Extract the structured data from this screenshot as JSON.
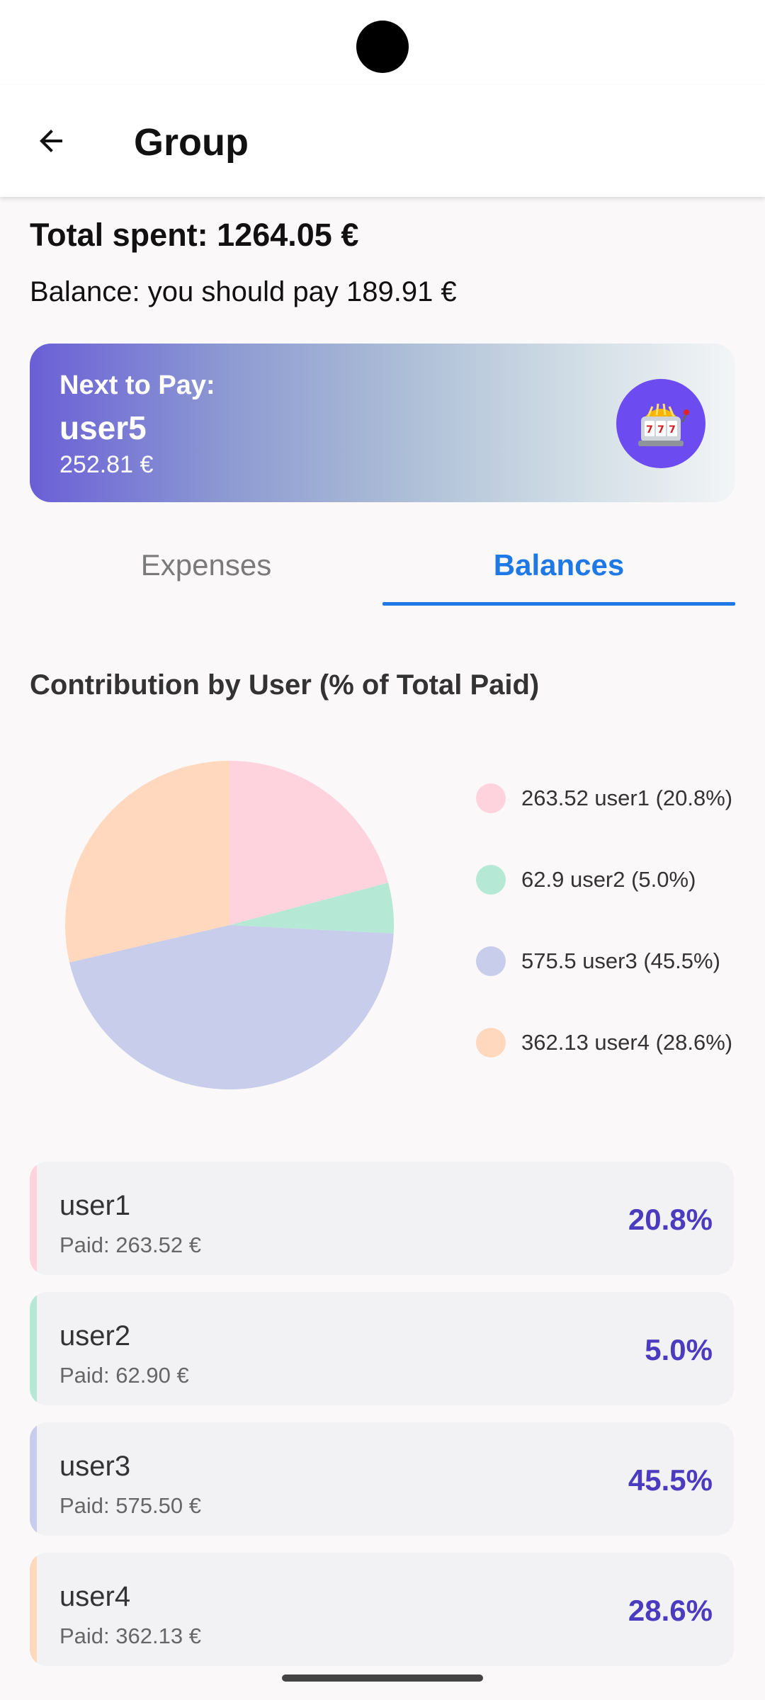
{
  "app_bar": {
    "title": "Group"
  },
  "summary": {
    "total_spent": "Total spent: 1264.05 €",
    "balance": "Balance: you should pay 189.91 €"
  },
  "next_to_pay": {
    "label": "Next to Pay:",
    "user": "user5",
    "amount": "252.81 €",
    "icon": "slot-machine-icon"
  },
  "tabs": [
    {
      "label": "Expenses",
      "selected": false
    },
    {
      "label": "Balances",
      "selected": true
    }
  ],
  "chart_data": {
    "type": "pie",
    "title": "Contribution by User (% of Total Paid)",
    "categories": [
      "user1",
      "user2",
      "user3",
      "user4"
    ],
    "values": [
      263.52,
      62.9,
      575.5,
      362.13
    ],
    "percent": [
      20.8,
      5.0,
      45.5,
      28.6
    ],
    "legend": [
      "263.52 user1 (20.8%)",
      "62.9 user2 (5.0%)",
      "575.5 user3 (45.5%)",
      "362.13 user4 (28.6%)"
    ],
    "colors": [
      "#ffd3de",
      "#b5e9d5",
      "#c7cdea",
      "#ffd8bd"
    ],
    "legend_position": "right"
  },
  "users": [
    {
      "name": "user1",
      "paid": "Paid: 263.52 €",
      "percent": "20.8%",
      "color": "#ffd3de"
    },
    {
      "name": "user2",
      "paid": "Paid: 62.90 €",
      "percent": "5.0%",
      "color": "#b5e9d5"
    },
    {
      "name": "user3",
      "paid": "Paid: 575.50 €",
      "percent": "45.5%",
      "color": "#c7cdea"
    },
    {
      "name": "user4",
      "paid": "Paid: 362.13 €",
      "percent": "28.6%",
      "color": "#ffd8bd"
    }
  ]
}
